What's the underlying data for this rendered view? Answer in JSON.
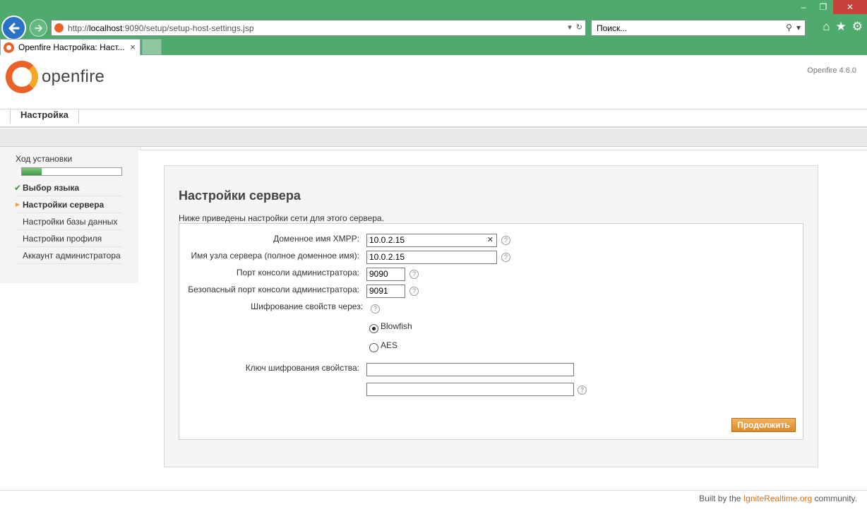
{
  "browser": {
    "url_prefix": "http://",
    "url_host": "localhost",
    "url_rest": ":9090/setup/setup-host-settings.jsp",
    "search_placeholder": "Поиск...",
    "tab_title": "Openfire Настройка: Наст...",
    "tab_close": "×",
    "controls": {
      "minimize": "–",
      "restore": "❐",
      "close": "✕"
    }
  },
  "header": {
    "logo_text": "openfire",
    "version": "Openfire 4.6.0"
  },
  "nav": {
    "setup_tab": "Настройка"
  },
  "sidebar": {
    "progress_title": "Ход установки",
    "progress_fraction": 0.2,
    "steps": [
      {
        "label": "Выбор языка",
        "state": "done"
      },
      {
        "label": "Настройки сервера",
        "state": "active"
      },
      {
        "label": "Настройки базы данных",
        "state": "pending"
      },
      {
        "label": "Настройки профиля",
        "state": "pending"
      },
      {
        "label": "Аккаунт администратора",
        "state": "pending"
      }
    ]
  },
  "main": {
    "title": "Настройки сервера",
    "description": "Ниже приведены настройки сети для этого сервера.",
    "fields": {
      "xmpp_domain_label": "Доменное имя XMPP:",
      "xmpp_domain_value": "10.0.2.15",
      "fqdn_label": "Имя узла сервера (полное доменное имя):",
      "fqdn_value": "10.0.2.15",
      "admin_port_label": "Порт консоли администратора:",
      "admin_port_value": "9090",
      "secure_port_label": "Безопасный порт консоли администратора:",
      "secure_port_value": "9091",
      "encryption_label": "Шифрование свойств через:",
      "encryption_options": [
        "Blowfish",
        "AES"
      ],
      "encryption_selected": "Blowfish",
      "key_label": "Ключ шифрования свойства:"
    },
    "continue_label": "Продолжить"
  },
  "footer": {
    "prefix": "Built by the ",
    "link": "IgniteRealtime.org",
    "suffix": " community."
  },
  "colors": {
    "chrome_green": "#4faa6e",
    "accent_orange": "#d98a2a",
    "progress_green": "#3f9a3f"
  }
}
